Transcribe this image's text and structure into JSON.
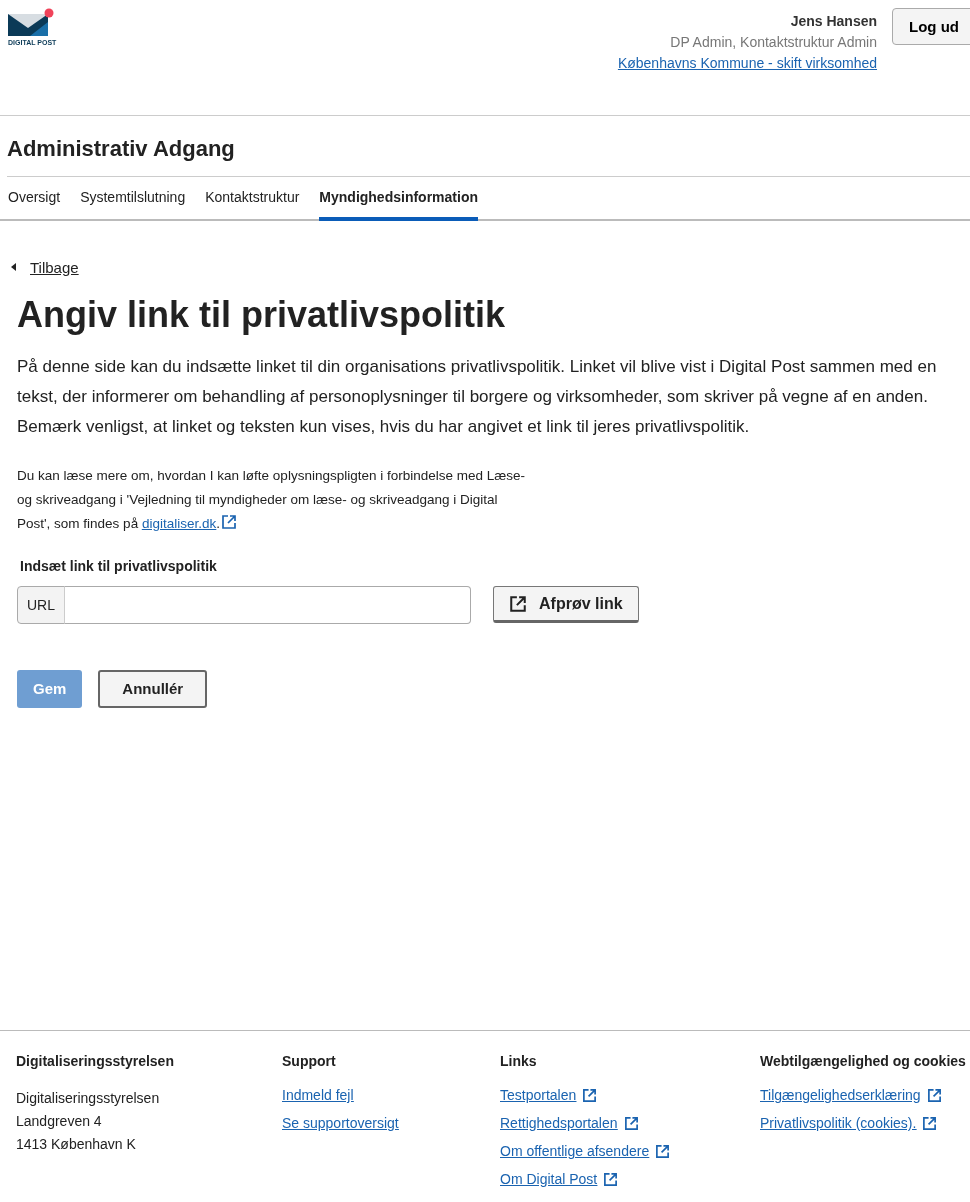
{
  "logo": {
    "text": "DIGITAL POST"
  },
  "user": {
    "name": "Jens Hansen",
    "roles": "DP Admin, Kontaktstruktur Admin",
    "org_link": "Københavns Kommune - skift virksomhed"
  },
  "logout": "Log ud",
  "section_title": "Administrativ Adgang",
  "tabs": [
    {
      "label": "Oversigt",
      "selected": false
    },
    {
      "label": "Systemtilslutning",
      "selected": false
    },
    {
      "label": "Kontaktstruktur",
      "selected": false
    },
    {
      "label": "Myndighedsinformation",
      "selected": true
    }
  ],
  "back": "Tilbage",
  "heading": "Angiv link til privatlivspolitik",
  "intro": "På denne side kan du indsætte linket til din organisations privatlivspolitik. Linket vil blive vist i Digital Post sammen med en tekst, der informerer om behandling af personoplysninger til borgere og virksomheder, som skriver på vegne af en anden. Bemærk venligst, at linket og teksten kun vises, hvis du har angivet et link til jeres privatlivspolitik.",
  "note": {
    "text": "Du kan læse mere om, hvordan I kan løfte oplysningspligten i forbindelse med Læse- og skriveadgang i 'Vejledning til myndigheder om læse- og skriveadgang i Digital Post', som findes på ",
    "link": "digitaliser.dk",
    "after": "."
  },
  "field": {
    "label": "Indsæt link til privatlivspolitik",
    "prefix": "URL"
  },
  "test_button": "Afprøv link",
  "buttons": [
    {
      "label": "Gem",
      "kind": "primary",
      "disabled": true
    },
    {
      "label": "Annullér",
      "kind": "secondary",
      "disabled": false
    }
  ],
  "footer": [
    {
      "heading": "Digitaliseringsstyrelsen",
      "lines": [
        "Digitaliseringsstyrelsen",
        "Landgreven 4",
        "1413 København K"
      ]
    },
    {
      "heading": "Support",
      "links": [
        {
          "label": "Indmeld fejl",
          "external": false
        },
        {
          "label": "Se supportoversigt",
          "external": false
        }
      ]
    },
    {
      "heading": "Links",
      "links": [
        {
          "label": "Testportalen",
          "external": true
        },
        {
          "label": "Rettighedsportalen",
          "external": true
        },
        {
          "label": "Om offentlige afsendere",
          "external": true
        },
        {
          "label": "Om Digital Post",
          "external": true
        }
      ]
    },
    {
      "heading": "Webtilgængelighed og cookies",
      "links": [
        {
          "label": "Tilgængelighedserklæring",
          "external": true
        },
        {
          "label": "Privatlivspolitik (cookies).",
          "external": true
        }
      ]
    }
  ]
}
